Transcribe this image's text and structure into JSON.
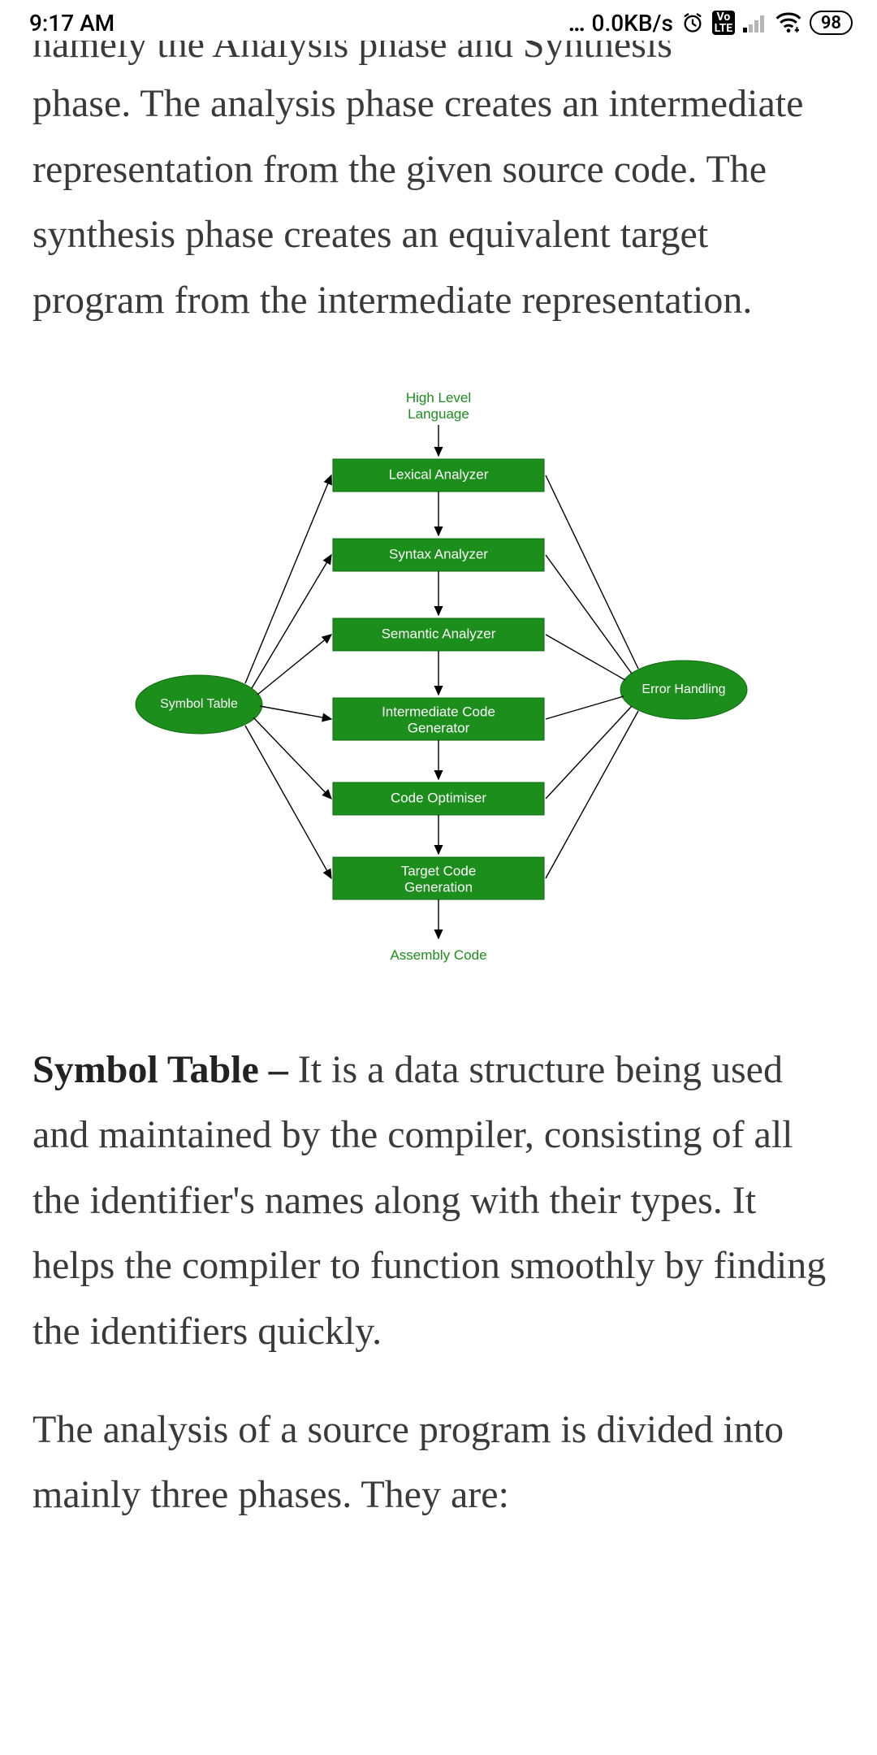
{
  "status": {
    "time": "9:17 AM",
    "net_speed": "0.0KB/s",
    "battery": "98"
  },
  "paragraphs": {
    "cutoff_line": "namely the Analysis phase and Synthesis",
    "p1": "phase. The analysis phase creates an intermediate representation from the given source code. The synthesis phase creates an equivalent target program from the intermediate representation.",
    "p2_lead": "Symbol Table – ",
    "p2_body": "It is a data structure being used and maintained by the compiler, consisting of all the identifier's names along with their types. It helps the compiler to function smoothly by finding the identifiers quickly.",
    "p3": "The analysis of a source program is divided into mainly three phases. They are:"
  },
  "diagram": {
    "top_label_l1": "High Level",
    "top_label_l2": "Language",
    "phases": {
      "lexical": "Lexical Analyzer",
      "syntax": "Syntax Analyzer",
      "semantic": "Semantic Analyzer",
      "icg_l1": "Intermediate Code",
      "icg_l2": "Generator",
      "opt": "Code Optimiser",
      "tcg_l1": "Target Code",
      "tcg_l2": "Generation",
      "bottom_label": "Assembly Code"
    },
    "left_node": "Symbol Table",
    "right_node": "Error Handling"
  }
}
